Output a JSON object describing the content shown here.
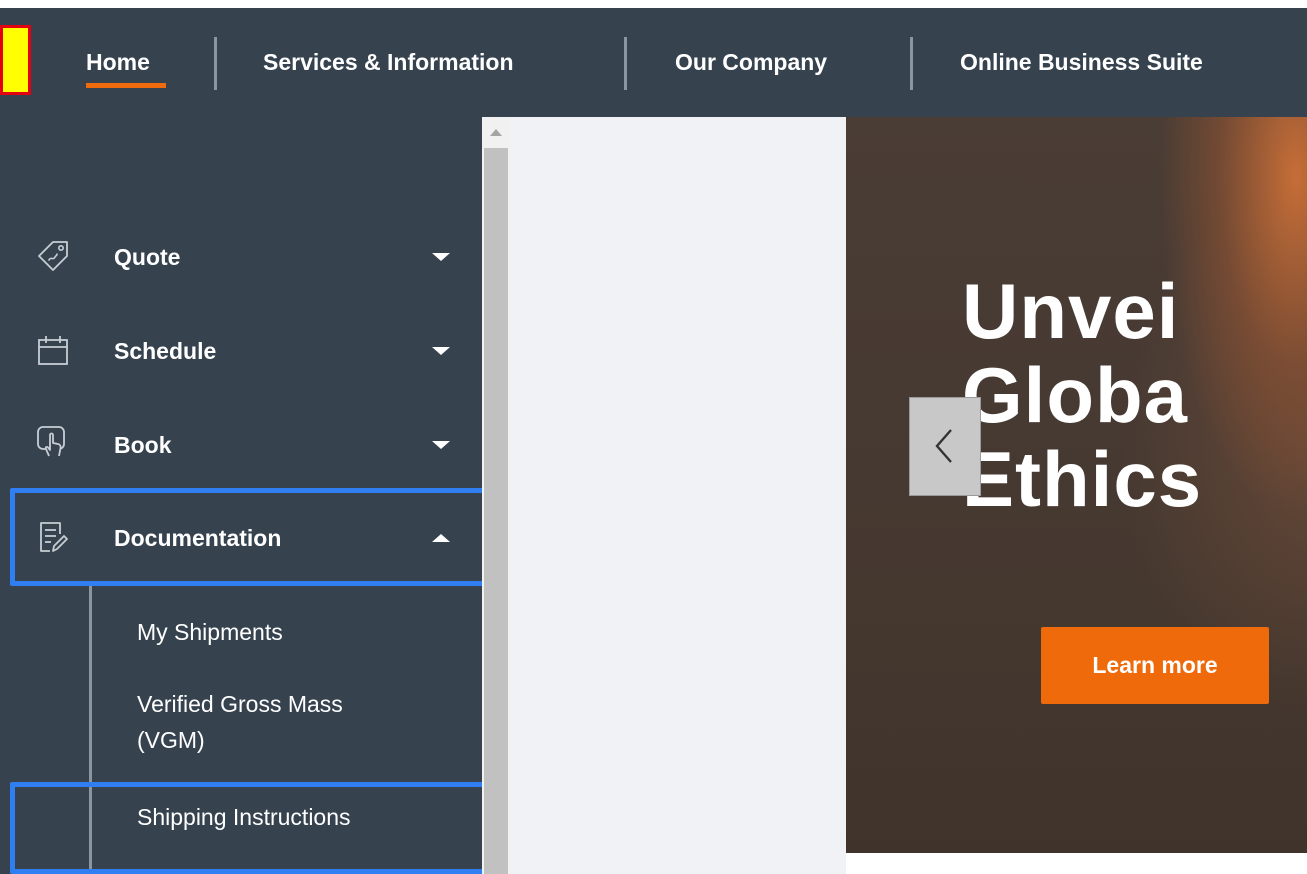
{
  "topnav": {
    "items": [
      {
        "label": "Home"
      },
      {
        "label": "Services & Information"
      },
      {
        "label": "Our Company"
      },
      {
        "label": "Online Business Suite"
      }
    ],
    "active_item": "Home"
  },
  "sidebar": {
    "menu": [
      {
        "label": "Quote",
        "icon": "price-tag-icon",
        "expanded": false
      },
      {
        "label": "Schedule",
        "icon": "calendar-icon",
        "expanded": false
      },
      {
        "label": "Book",
        "icon": "touch-tap-icon",
        "expanded": false
      },
      {
        "label": "Documentation",
        "icon": "document-edit-icon",
        "expanded": true
      }
    ],
    "submenu": [
      {
        "label": "My Shipments"
      },
      {
        "label": "Verified Gross Mass",
        "label_line2": "(VGM)"
      },
      {
        "label": "Shipping Instructions"
      }
    ]
  },
  "hero": {
    "title_line1": "Unvei",
    "title_line2": "Globa",
    "title_line3": "Ethics",
    "button_label": "Learn more",
    "prev_icon": "chevron-left-icon"
  },
  "colors": {
    "nav_bg": "#36434f",
    "accent_orange": "#ee6a0b",
    "highlight_blue": "#2f7ff2",
    "marker_yellow": "#ffff00",
    "marker_red": "#e3000f"
  }
}
